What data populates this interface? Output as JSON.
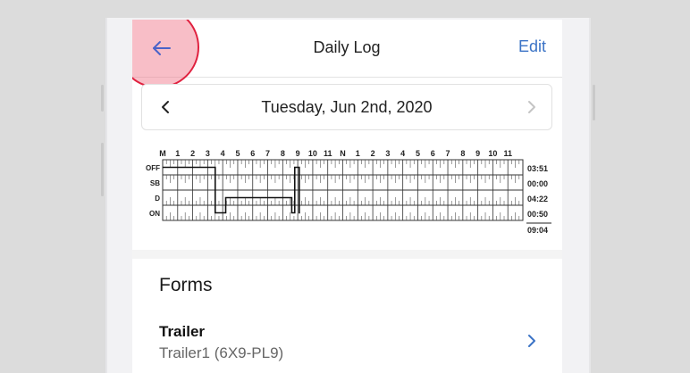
{
  "nav": {
    "title": "Daily Log",
    "edit_label": "Edit",
    "back_icon": "arrow-left-icon"
  },
  "date_bar": {
    "date": "Tuesday, Jun 2nd, 2020",
    "prev_icon": "chevron-left-icon",
    "next_icon": "chevron-right-icon"
  },
  "log_graph": {
    "hour_labels": [
      "M",
      "1",
      "2",
      "3",
      "4",
      "5",
      "6",
      "7",
      "8",
      "9",
      "10",
      "11",
      "N",
      "1",
      "2",
      "3",
      "4",
      "5",
      "6",
      "7",
      "8",
      "9",
      "10",
      "11"
    ],
    "rows": [
      {
        "status": "OFF",
        "total": "03:51"
      },
      {
        "status": "SB",
        "total": "00:00"
      },
      {
        "status": "D",
        "total": "04:22"
      },
      {
        "status": "ON",
        "total": "00:50"
      }
    ],
    "grand_total": "09:04",
    "segments": [
      {
        "status": "OFF",
        "start_hour": 0,
        "end_hour": 3.5
      },
      {
        "status": "ON",
        "start_hour": 3.5,
        "end_hour": 4.2
      },
      {
        "status": "D",
        "start_hour": 4.2,
        "end_hour": 8.6
      },
      {
        "status": "ON",
        "start_hour": 8.6,
        "end_hour": 8.8
      },
      {
        "status": "OFF",
        "start_hour": 8.8,
        "end_hour": 9.1
      },
      {
        "status": "ON",
        "start_hour": 9.1,
        "end_hour": 9.15
      }
    ]
  },
  "forms": {
    "heading": "Forms",
    "items": [
      {
        "title": "Trailer",
        "value": "Trailer1 (6X9-PL9)"
      }
    ]
  },
  "colors": {
    "accent": "#3b73c6",
    "highlight_ring": "#e0213f"
  }
}
